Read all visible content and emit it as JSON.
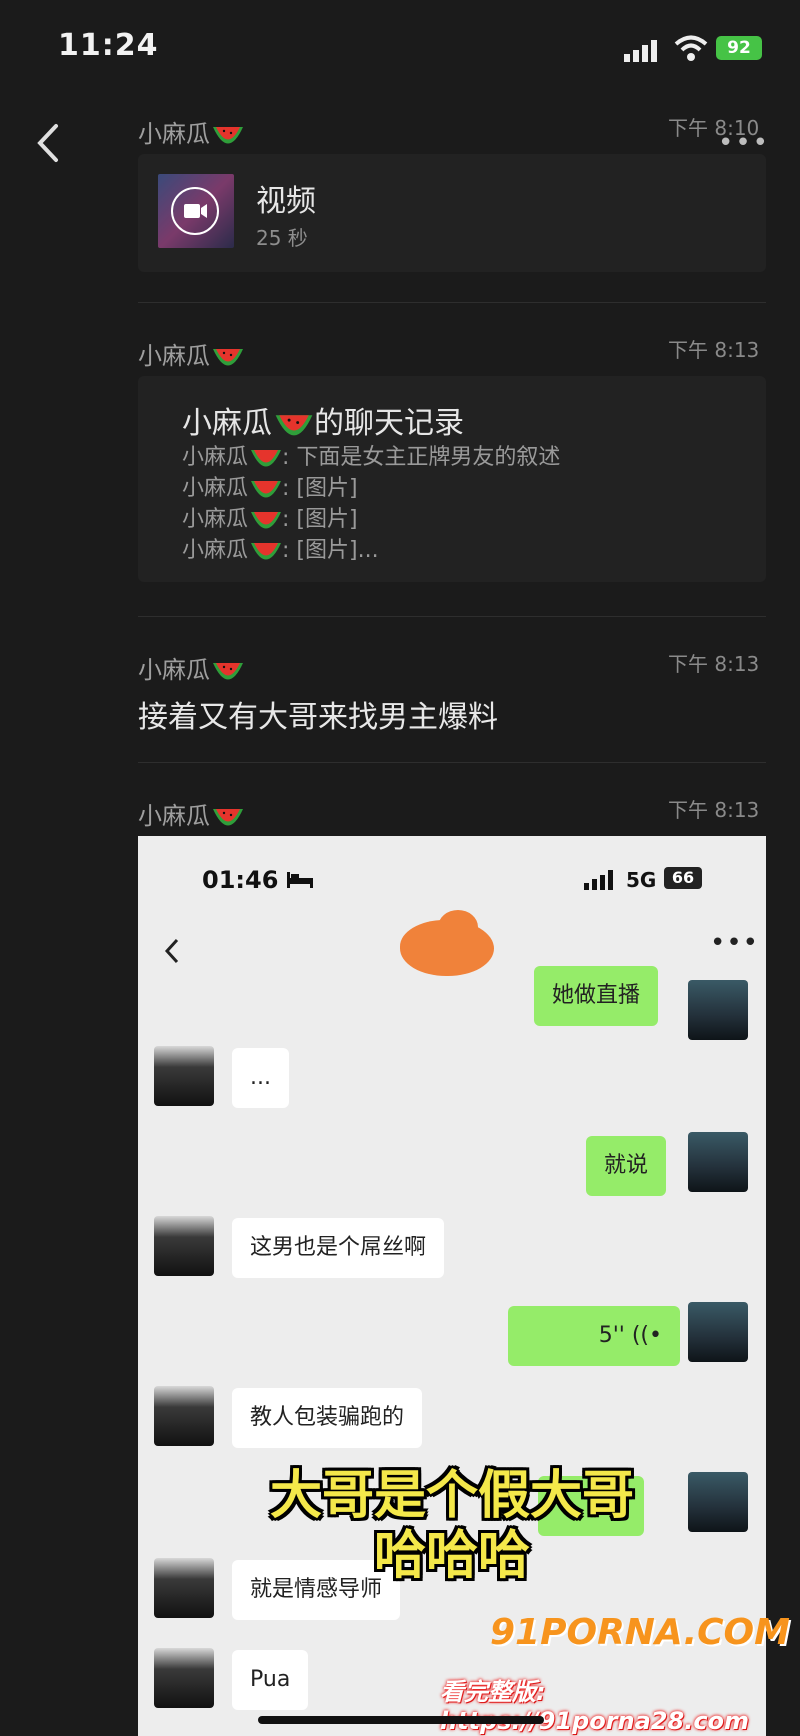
{
  "status_bar": {
    "time": "11:24",
    "battery": "92"
  },
  "messages": [
    {
      "sender": "小麻瓜",
      "time": "下午 8:10",
      "type": "video",
      "title": "视频",
      "duration": "25 秒"
    },
    {
      "sender": "小麻瓜",
      "time": "下午 8:13",
      "type": "chat_record",
      "title": "小麻瓜",
      "title_suffix": "的聊天记录",
      "lines": [
        {
          "name": "小麻瓜",
          "text": ": 下面是女主正牌男友的叙述"
        },
        {
          "name": "小麻瓜",
          "text": ": [图片]"
        },
        {
          "name": "小麻瓜",
          "text": ": [图片]"
        },
        {
          "name": "小麻瓜",
          "text": ": [图片]..."
        }
      ]
    },
    {
      "sender": "小麻瓜",
      "time": "下午 8:13",
      "type": "text",
      "text": "接着又有大哥来找男主爆料"
    },
    {
      "sender": "小麻瓜",
      "time": "下午 8:13",
      "type": "image"
    }
  ],
  "screenshot": {
    "time": "01:46",
    "network": "5G",
    "battery": "66",
    "chat": [
      {
        "side": "right",
        "text": "她做直播"
      },
      {
        "side": "left",
        "text": "..."
      },
      {
        "side": "right",
        "text": "就说"
      },
      {
        "side": "left",
        "text": "这男也是个屌丝啊"
      },
      {
        "side": "right",
        "text": "5''"
      },
      {
        "side": "left",
        "text": "教人包装骗跑的"
      },
      {
        "side": "left",
        "text": "就是情感导师"
      },
      {
        "side": "left",
        "text": "Pua"
      }
    ],
    "caption_line1": "大哥是个假大哥",
    "caption_line2": "哈哈哈"
  },
  "watermark": {
    "brand": "91PORNA.COM",
    "url_line": "看完整版: https://91porna28.com"
  },
  "colors": {
    "background": "#1b1b1b",
    "card": "#222222",
    "battery_green": "#46c346",
    "bubble_green": "#95ec69",
    "caption_yellow": "#f4e84a"
  }
}
